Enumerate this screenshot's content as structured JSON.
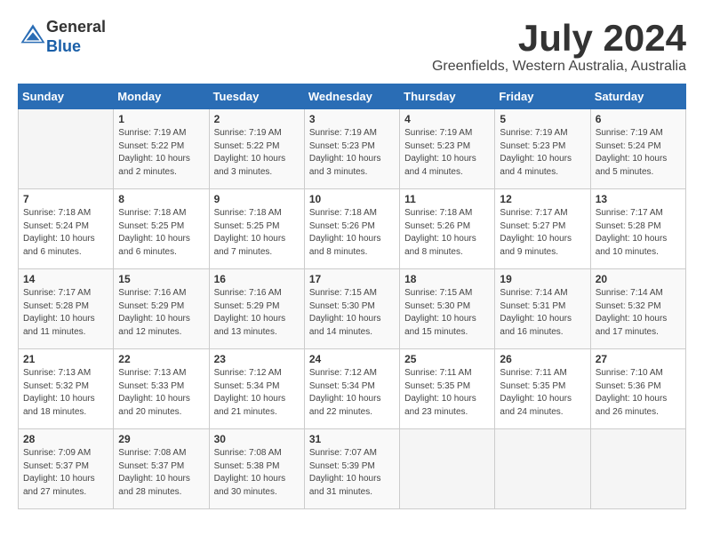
{
  "header": {
    "logo_line1": "General",
    "logo_line2": "Blue",
    "month": "July 2024",
    "location": "Greenfields, Western Australia, Australia"
  },
  "weekdays": [
    "Sunday",
    "Monday",
    "Tuesday",
    "Wednesday",
    "Thursday",
    "Friday",
    "Saturday"
  ],
  "weeks": [
    [
      {
        "day": "",
        "sunrise": "",
        "sunset": "",
        "daylight": ""
      },
      {
        "day": "1",
        "sunrise": "Sunrise: 7:19 AM",
        "sunset": "Sunset: 5:22 PM",
        "daylight": "Daylight: 10 hours and 2 minutes."
      },
      {
        "day": "2",
        "sunrise": "Sunrise: 7:19 AM",
        "sunset": "Sunset: 5:22 PM",
        "daylight": "Daylight: 10 hours and 3 minutes."
      },
      {
        "day": "3",
        "sunrise": "Sunrise: 7:19 AM",
        "sunset": "Sunset: 5:23 PM",
        "daylight": "Daylight: 10 hours and 3 minutes."
      },
      {
        "day": "4",
        "sunrise": "Sunrise: 7:19 AM",
        "sunset": "Sunset: 5:23 PM",
        "daylight": "Daylight: 10 hours and 4 minutes."
      },
      {
        "day": "5",
        "sunrise": "Sunrise: 7:19 AM",
        "sunset": "Sunset: 5:23 PM",
        "daylight": "Daylight: 10 hours and 4 minutes."
      },
      {
        "day": "6",
        "sunrise": "Sunrise: 7:19 AM",
        "sunset": "Sunset: 5:24 PM",
        "daylight": "Daylight: 10 hours and 5 minutes."
      }
    ],
    [
      {
        "day": "7",
        "sunrise": "Sunrise: 7:18 AM",
        "sunset": "Sunset: 5:24 PM",
        "daylight": "Daylight: 10 hours and 6 minutes."
      },
      {
        "day": "8",
        "sunrise": "Sunrise: 7:18 AM",
        "sunset": "Sunset: 5:25 PM",
        "daylight": "Daylight: 10 hours and 6 minutes."
      },
      {
        "day": "9",
        "sunrise": "Sunrise: 7:18 AM",
        "sunset": "Sunset: 5:25 PM",
        "daylight": "Daylight: 10 hours and 7 minutes."
      },
      {
        "day": "10",
        "sunrise": "Sunrise: 7:18 AM",
        "sunset": "Sunset: 5:26 PM",
        "daylight": "Daylight: 10 hours and 8 minutes."
      },
      {
        "day": "11",
        "sunrise": "Sunrise: 7:18 AM",
        "sunset": "Sunset: 5:26 PM",
        "daylight": "Daylight: 10 hours and 8 minutes."
      },
      {
        "day": "12",
        "sunrise": "Sunrise: 7:17 AM",
        "sunset": "Sunset: 5:27 PM",
        "daylight": "Daylight: 10 hours and 9 minutes."
      },
      {
        "day": "13",
        "sunrise": "Sunrise: 7:17 AM",
        "sunset": "Sunset: 5:28 PM",
        "daylight": "Daylight: 10 hours and 10 minutes."
      }
    ],
    [
      {
        "day": "14",
        "sunrise": "Sunrise: 7:17 AM",
        "sunset": "Sunset: 5:28 PM",
        "daylight": "Daylight: 10 hours and 11 minutes."
      },
      {
        "day": "15",
        "sunrise": "Sunrise: 7:16 AM",
        "sunset": "Sunset: 5:29 PM",
        "daylight": "Daylight: 10 hours and 12 minutes."
      },
      {
        "day": "16",
        "sunrise": "Sunrise: 7:16 AM",
        "sunset": "Sunset: 5:29 PM",
        "daylight": "Daylight: 10 hours and 13 minutes."
      },
      {
        "day": "17",
        "sunrise": "Sunrise: 7:15 AM",
        "sunset": "Sunset: 5:30 PM",
        "daylight": "Daylight: 10 hours and 14 minutes."
      },
      {
        "day": "18",
        "sunrise": "Sunrise: 7:15 AM",
        "sunset": "Sunset: 5:30 PM",
        "daylight": "Daylight: 10 hours and 15 minutes."
      },
      {
        "day": "19",
        "sunrise": "Sunrise: 7:14 AM",
        "sunset": "Sunset: 5:31 PM",
        "daylight": "Daylight: 10 hours and 16 minutes."
      },
      {
        "day": "20",
        "sunrise": "Sunrise: 7:14 AM",
        "sunset": "Sunset: 5:32 PM",
        "daylight": "Daylight: 10 hours and 17 minutes."
      }
    ],
    [
      {
        "day": "21",
        "sunrise": "Sunrise: 7:13 AM",
        "sunset": "Sunset: 5:32 PM",
        "daylight": "Daylight: 10 hours and 18 minutes."
      },
      {
        "day": "22",
        "sunrise": "Sunrise: 7:13 AM",
        "sunset": "Sunset: 5:33 PM",
        "daylight": "Daylight: 10 hours and 20 minutes."
      },
      {
        "day": "23",
        "sunrise": "Sunrise: 7:12 AM",
        "sunset": "Sunset: 5:34 PM",
        "daylight": "Daylight: 10 hours and 21 minutes."
      },
      {
        "day": "24",
        "sunrise": "Sunrise: 7:12 AM",
        "sunset": "Sunset: 5:34 PM",
        "daylight": "Daylight: 10 hours and 22 minutes."
      },
      {
        "day": "25",
        "sunrise": "Sunrise: 7:11 AM",
        "sunset": "Sunset: 5:35 PM",
        "daylight": "Daylight: 10 hours and 23 minutes."
      },
      {
        "day": "26",
        "sunrise": "Sunrise: 7:11 AM",
        "sunset": "Sunset: 5:35 PM",
        "daylight": "Daylight: 10 hours and 24 minutes."
      },
      {
        "day": "27",
        "sunrise": "Sunrise: 7:10 AM",
        "sunset": "Sunset: 5:36 PM",
        "daylight": "Daylight: 10 hours and 26 minutes."
      }
    ],
    [
      {
        "day": "28",
        "sunrise": "Sunrise: 7:09 AM",
        "sunset": "Sunset: 5:37 PM",
        "daylight": "Daylight: 10 hours and 27 minutes."
      },
      {
        "day": "29",
        "sunrise": "Sunrise: 7:08 AM",
        "sunset": "Sunset: 5:37 PM",
        "daylight": "Daylight: 10 hours and 28 minutes."
      },
      {
        "day": "30",
        "sunrise": "Sunrise: 7:08 AM",
        "sunset": "Sunset: 5:38 PM",
        "daylight": "Daylight: 10 hours and 30 minutes."
      },
      {
        "day": "31",
        "sunrise": "Sunrise: 7:07 AM",
        "sunset": "Sunset: 5:39 PM",
        "daylight": "Daylight: 10 hours and 31 minutes."
      },
      {
        "day": "",
        "sunrise": "",
        "sunset": "",
        "daylight": ""
      },
      {
        "day": "",
        "sunrise": "",
        "sunset": "",
        "daylight": ""
      },
      {
        "day": "",
        "sunrise": "",
        "sunset": "",
        "daylight": ""
      }
    ]
  ]
}
